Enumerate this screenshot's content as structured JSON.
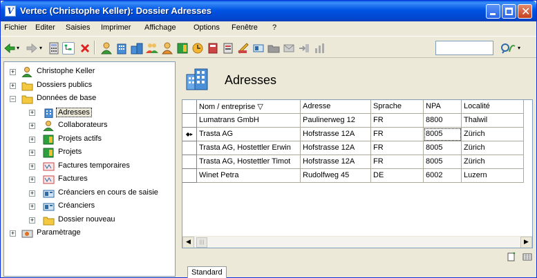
{
  "window": {
    "title": "Vertec (Christophe Keller): Dossier Adresses",
    "app_icon_letter": "V"
  },
  "menu": [
    "Fichier",
    "Editer",
    "Saisies",
    "Imprimer",
    "Affichage",
    "Options",
    "Fenêtre",
    "?"
  ],
  "tree": {
    "items": [
      {
        "label": "Christophe Keller",
        "icon": "user-icon",
        "expander": "+"
      },
      {
        "label": "Dossiers publics",
        "icon": "folder-icon",
        "expander": "+"
      },
      {
        "label": "Données de base",
        "icon": "folder-icon",
        "expander": "−"
      },
      {
        "label": "Adresses",
        "icon": "building-icon",
        "expander": "+"
      },
      {
        "label": "Collaborateurs",
        "icon": "user-icon",
        "expander": "+"
      },
      {
        "label": "Projets actifs",
        "icon": "project-icon",
        "expander": "+"
      },
      {
        "label": "Projets",
        "icon": "project-icon",
        "expander": "+"
      },
      {
        "label": "Factures temporaires",
        "icon": "invoice-icon",
        "expander": "+"
      },
      {
        "label": "Factures",
        "icon": "invoice-icon",
        "expander": "+"
      },
      {
        "label": "Créanciers en cours de saisie",
        "icon": "creditor-icon",
        "expander": "+"
      },
      {
        "label": "Créanciers",
        "icon": "creditor-icon",
        "expander": "+"
      },
      {
        "label": "Dossier nouveau",
        "icon": "folder-icon",
        "expander": "+"
      },
      {
        "label": "Paramètrage",
        "icon": "settings-icon",
        "expander": "+"
      }
    ]
  },
  "content": {
    "title": "Adresses",
    "columns": [
      "Nom / entreprise ▽",
      "Adresse",
      "Sprache",
      "NPA",
      "Localité"
    ],
    "rows": [
      [
        "Lumatrans GmbH",
        "Paulinerweg 12",
        "FR",
        "8800",
        "Thalwil"
      ],
      [
        "Trasta AG",
        "Hofstrasse 12A",
        "FR",
        "8005",
        "Zürich"
      ],
      [
        "Trasta AG, Hostettler Erwin",
        "Hofstrasse 12A",
        "FR",
        "8005",
        "Zürich"
      ],
      [
        "Trasta AG, Hostettler Timot",
        "Hofstrasse 12A",
        "FR",
        "8005",
        "Zürich"
      ],
      [
        "Winet Petra",
        "Rudolfweg 45",
        "DE",
        "6002",
        "Luzern"
      ]
    ],
    "current_row_marker": "◆▸",
    "scroll_left": "◀",
    "scroll_right": "▶",
    "thumb_grip": "|||",
    "tab": "Standard"
  },
  "colors": {
    "titlebar": "#0054e3",
    "selection_bg": "#ece9d8"
  }
}
